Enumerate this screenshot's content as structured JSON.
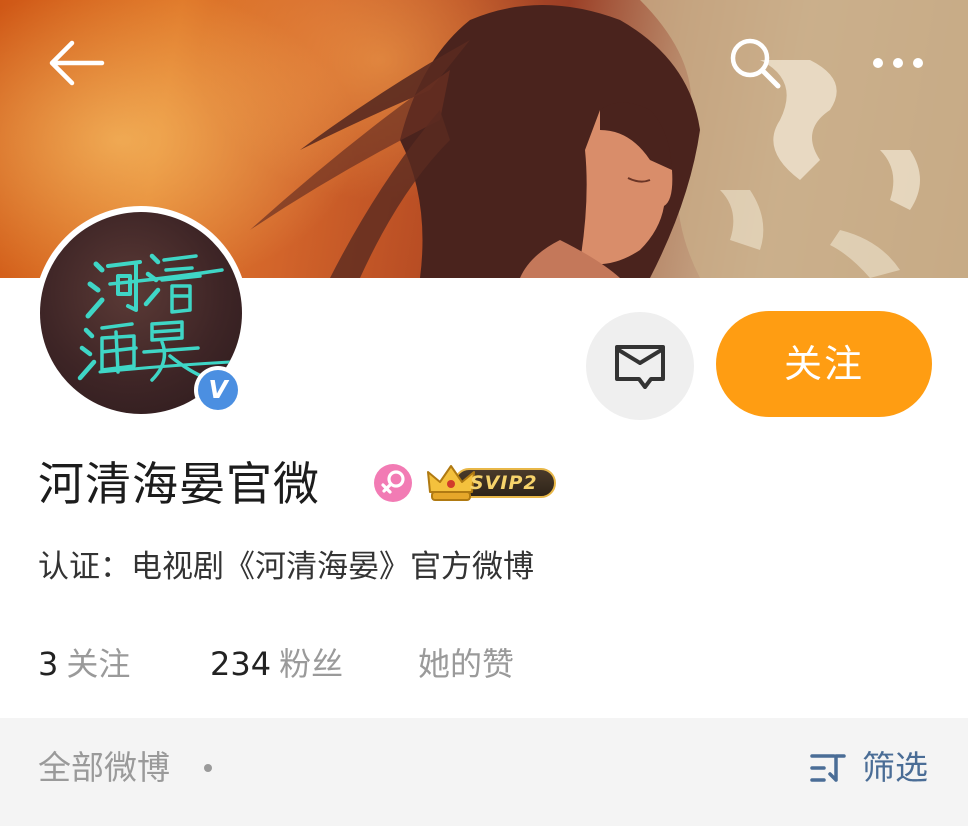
{
  "nav": {
    "back_icon": "back-arrow-icon",
    "search_icon": "search-icon",
    "more_icon": "more-dots-icon"
  },
  "profile": {
    "avatar_text": "河清海晏",
    "verified_mark": "V",
    "name": "河清海晏官微",
    "gender": "female",
    "svip_label": "SVIP2",
    "verification": "认证：电视剧《河清海晏》官方微博"
  },
  "actions": {
    "message_icon": "message-envelope-icon",
    "follow_label": "关注"
  },
  "stats": {
    "following_count": "3",
    "following_label": "关注",
    "followers_count": "234",
    "followers_label": "粉丝",
    "likes_label": "她的赞"
  },
  "feed_bar": {
    "all_posts_label": "全部微博",
    "filter_label": "筛选"
  },
  "colors": {
    "follow_button": "#ff9d12",
    "verified_badge": "#4b8fe1",
    "gender_badge": "#f27bb4",
    "filter_text": "#4a6d96",
    "muted_text": "#9a9a9a",
    "avatar_calligraphy": "#3fd6c6"
  }
}
